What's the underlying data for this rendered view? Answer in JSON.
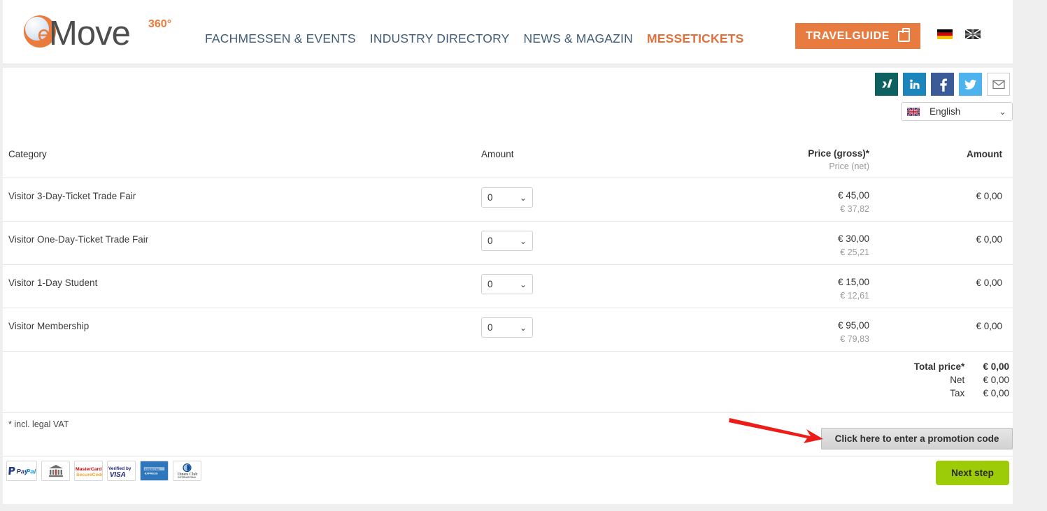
{
  "brand": {
    "logo_text": "Move",
    "logo_mark_letter": "e",
    "logo_superscript": "360°"
  },
  "header": {
    "nav": [
      {
        "label": "FACHMESSEN & EVENTS",
        "active": false
      },
      {
        "label": "INDUSTRY DIRECTORY",
        "active": false
      },
      {
        "label": "NEWS & MAGAZIN",
        "active": false
      },
      {
        "label": "MESSETICKETS",
        "active": true
      }
    ],
    "travelguide_label": "TRAVELGUIDE",
    "flags": [
      {
        "name": "german-flag",
        "title": "Deutsch"
      },
      {
        "name": "english-flag",
        "title": "English"
      }
    ]
  },
  "social": [
    {
      "name": "xing-icon",
      "label": "X"
    },
    {
      "name": "linkedin-icon",
      "label": "in"
    },
    {
      "name": "facebook-icon",
      "label": "f"
    },
    {
      "name": "twitter-icon",
      "label": "t"
    },
    {
      "name": "email-icon",
      "label": "✉"
    }
  ],
  "language": {
    "selected": "English",
    "chevron": "⌄"
  },
  "table": {
    "headers": {
      "category": "Category",
      "amount": "Amount",
      "price_gross": "Price (gross)*",
      "price_net": "Price (net)",
      "total": "Amount"
    },
    "rows": [
      {
        "category": "Visitor 3-Day-Ticket Trade Fair",
        "quantity": "0",
        "price_gross": "€ 45,00",
        "price_net": "€ 37,82",
        "amount": "€ 0,00"
      },
      {
        "category": "Visitor One-Day-Ticket Trade Fair",
        "quantity": "0",
        "price_gross": "€ 30,00",
        "price_net": "€ 25,21",
        "amount": "€ 0,00"
      },
      {
        "category": "Visitor 1-Day Student",
        "quantity": "0",
        "price_gross": "€ 15,00",
        "price_net": "€ 12,61",
        "amount": "€ 0,00"
      },
      {
        "category": "Visitor Membership",
        "quantity": "0",
        "price_gross": "€ 95,00",
        "price_net": "€ 79,83",
        "amount": "€ 0,00"
      }
    ]
  },
  "totals": [
    {
      "label": "Total price*",
      "value": "€ 0,00",
      "bold": true
    },
    {
      "label": "Net",
      "value": "€ 0,00",
      "bold": false
    },
    {
      "label": "Tax",
      "value": "€ 0,00",
      "bold": false
    }
  ],
  "footer": {
    "vat_note": "* incl. legal VAT",
    "promo_label": "Click here to enter a promotion code",
    "next_label": "Next step",
    "payment_methods": [
      {
        "name": "paypal-logo",
        "text": "PayPal"
      },
      {
        "name": "bank-transfer-logo",
        "text": ""
      },
      {
        "name": "mastercard-securecode-logo",
        "text": "MasterCard SecureCode"
      },
      {
        "name": "verified-by-visa-logo",
        "text": "Verified by VISA"
      },
      {
        "name": "american-express-logo",
        "text": "AMERICAN EXPRESS"
      },
      {
        "name": "diners-club-logo",
        "text": "Diners Club INTERNATIONAL"
      }
    ]
  },
  "annotation": {
    "arrow_color": "#ee1c16",
    "points_to": "promotion-code-button"
  },
  "colors": {
    "accent_orange": "#e87b3f",
    "nav_blue": "#3f5b77",
    "next_green": "#9ccb08",
    "page_background": "#efefef"
  }
}
